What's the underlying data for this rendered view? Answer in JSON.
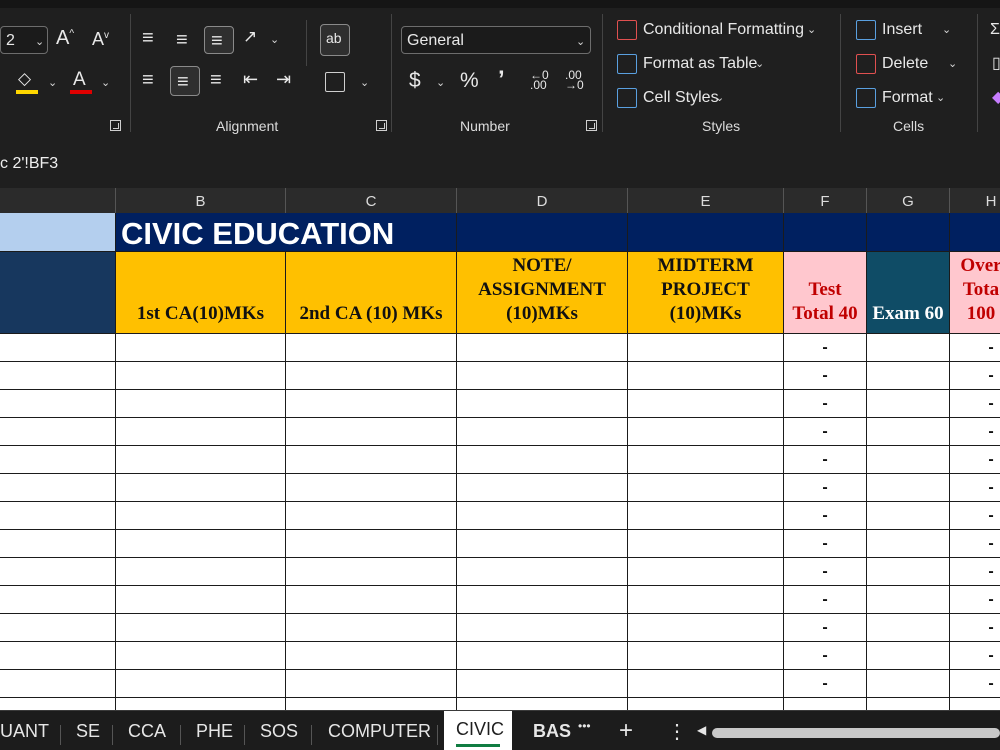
{
  "ribbon": {
    "font_size_value": "2",
    "grow_font_label": "A",
    "shrink_font_label": "A",
    "font_color_letter": "A",
    "wrap_text_label": "ab",
    "number_format_value": "General",
    "currency_symbol": "$",
    "percent_symbol": "%",
    "comma_symbol": "’",
    "conditional_formatting_label": "Conditional Formatting",
    "format_as_table_label": "Format as Table",
    "cell_styles_label": "Cell Styles",
    "insert_label": "Insert",
    "delete_label": "Delete",
    "format_label": "Format",
    "groups": {
      "alignment": "Alignment",
      "number": "Number",
      "styles": "Styles",
      "cells": "Cells"
    },
    "colors": {
      "fill_color_bar": "#ffd700",
      "font_color_bar": "#e00000"
    }
  },
  "formula_bar": {
    "name_box": "c 2'!BF3"
  },
  "grid": {
    "columns": [
      "B",
      "C",
      "D",
      "E",
      "F",
      "G",
      "H"
    ],
    "title": "CIVIC EDUCATION",
    "headers": {
      "b": [
        "1st CA(10)MKs"
      ],
      "c": [
        "2nd CA (10) MKs"
      ],
      "d": [
        "NOTE/",
        "ASSIGNMENT",
        "(10)MKs"
      ],
      "e": [
        "MIDTERM",
        "PROJECT",
        "(10)MKs"
      ],
      "f": [
        "Test",
        "Total 40"
      ],
      "g": [
        "Exam 60"
      ],
      "h": [
        "Over",
        "Tota",
        "100"
      ]
    },
    "row_placeholder": "-",
    "colors": {
      "title_band": "#002060",
      "header_gold": "#ffc000",
      "header_pink": "#ffc7ce",
      "header_teal": "#0f4c66",
      "pink_text": "#c00000",
      "left_top_cell": "#b4cfee",
      "left_header_cell": "#17375e"
    }
  },
  "sheet_tabs": {
    "tabs": [
      "UANT",
      "SE",
      "CCA",
      "PHE",
      "SOS",
      "COMPUTER",
      "CIVIC",
      "BAS"
    ],
    "active": "CIVIC",
    "more_label": "•••",
    "add_label": "+",
    "options_label": "⋮"
  }
}
